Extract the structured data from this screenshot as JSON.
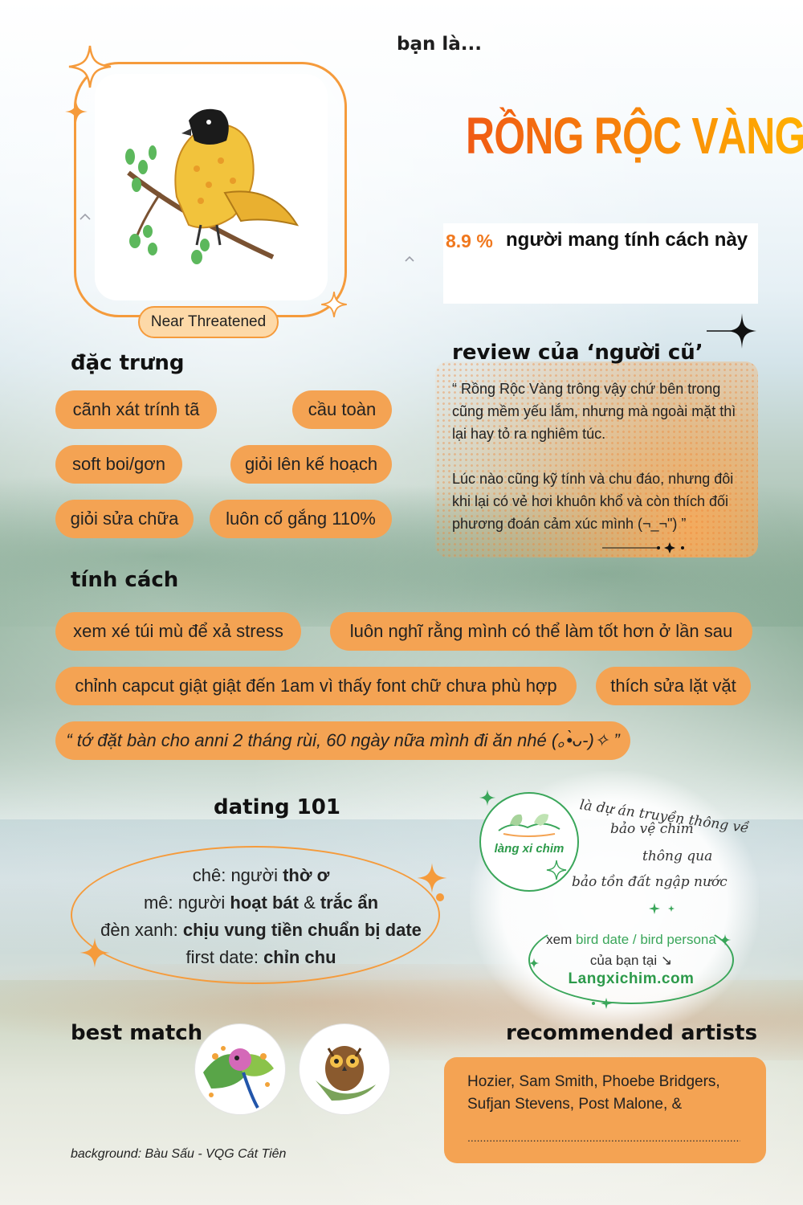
{
  "intro": "bạn là...",
  "bird_name": "RỒNG RỘC VÀNG",
  "conservation_status": "Near Threatened",
  "percent": "8.9 %",
  "percent_text": "người mang tính cách này",
  "traits_heading": "đặc trưng",
  "traits": [
    "cãnh xát trính tã",
    "cầu toàn",
    "soft boi/gơn",
    "giỏi lên kế hoạch",
    "giỏi sửa chữa",
    "luôn cố gắng 110%"
  ],
  "review": {
    "heading": "review của ‘người cũ’",
    "paragraph1": "“  Rồng Rộc Vàng trông vậy chứ bên trong cũng mềm yếu lắm, nhưng mà ngoài mặt thì lại hay tỏ ra nghiêm túc.",
    "paragraph2": "Lúc nào cũng kỹ tính và chu đáo, nhưng đôi khi lại có vẻ hơi khuôn khổ và còn thích đối phương đoán cảm xúc mình  (¬_¬\")  ”"
  },
  "personality_heading": "tính cách",
  "personality": [
    "xem xé túi mù để xả stress",
    "luôn nghĩ rằng mình có thể làm tốt hơn ở lần sau",
    "chỉnh capcut giật giật đến 1am vì thấy font chữ chưa phù hợp",
    "thích sửa lặt vặt",
    "“ tớ đặt bàn cho anni 2 tháng rùi, 60 ngày nữa mình đi ăn nhé  (｡•̀ᴗ-)✧  ”"
  ],
  "dating": {
    "heading": "dating 101",
    "che_label": "chê: người ",
    "che_value": "thờ ơ",
    "me_label": "mê: người ",
    "me_value1": "hoạt bát",
    "me_and": " & ",
    "me_value2": "trắc ẩn",
    "green_label": "đèn xanh: ",
    "green_value": "chịu vung tiền chuẩn bị date",
    "first_label": "first date: ",
    "first_value": "chỉn chu"
  },
  "promo": {
    "logo": "làng xi chim",
    "line1": "là dự án truyền thông về",
    "line2": "bảo vệ chim",
    "line3": "thông qua",
    "line4": "bảo tồn đất ngập nước",
    "cta_prefix": "xem ",
    "cta_highlight": "bird date / bird persona",
    "cta_suffix": "của bạn tại ↘",
    "website": "Langxichim.com"
  },
  "best_match_heading": "best match",
  "recommended": {
    "heading": "recommended artists",
    "artists": "Hozier, Sam Smith, Phoebe Bridgers, Sufjan Stevens, Post Malone, &",
    "blank": "............................................................................................"
  },
  "caption": "background: Bàu Sấu - VQG Cát Tiên",
  "colors": {
    "accent": "#f4a353",
    "title_start": "#f05a14",
    "title_end": "#ffb000",
    "green": "#3aa65a"
  },
  "icons": [
    "sparkle-icon",
    "bird-illustration",
    "bird-avatar-parrot",
    "bird-avatar-owl",
    "logo-birds-icon"
  ]
}
